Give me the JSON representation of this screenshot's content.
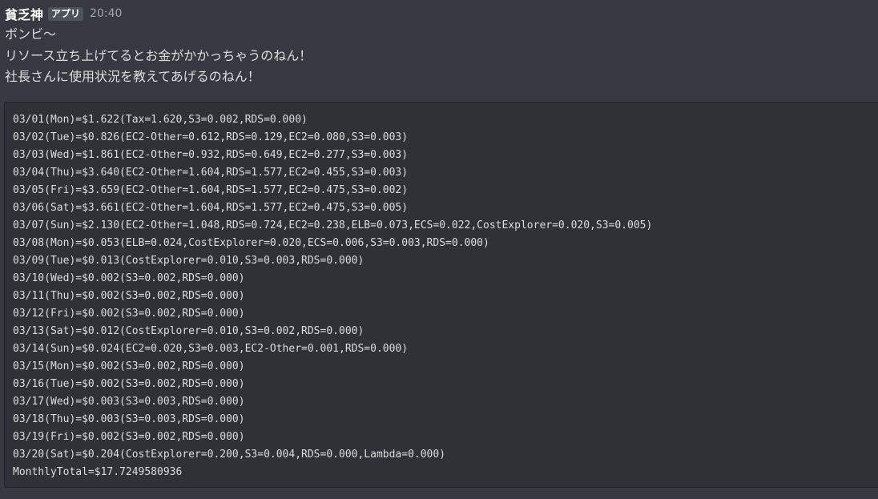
{
  "message": {
    "author": "貧乏神",
    "tag": "アプリ",
    "time": "20:40",
    "lines": [
      "ボンビ〜",
      "リソース立ち上げてるとお金がかかっちゃうのねん！",
      "社長さんに使用状況を教えてあげるのねん！"
    ]
  },
  "codeblock": {
    "lines": [
      "03/01(Mon)=$1.622(Tax=1.620,S3=0.002,RDS=0.000)",
      "03/02(Tue)=$0.826(EC2-Other=0.612,RDS=0.129,EC2=0.080,S3=0.003)",
      "03/03(Wed)=$1.861(EC2-Other=0.932,RDS=0.649,EC2=0.277,S3=0.003)",
      "03/04(Thu)=$3.640(EC2-Other=1.604,RDS=1.577,EC2=0.455,S3=0.003)",
      "03/05(Fri)=$3.659(EC2-Other=1.604,RDS=1.577,EC2=0.475,S3=0.002)",
      "03/06(Sat)=$3.661(EC2-Other=1.604,RDS=1.577,EC2=0.475,S3=0.005)",
      "03/07(Sun)=$2.130(EC2-Other=1.048,RDS=0.724,EC2=0.238,ELB=0.073,ECS=0.022,CostExplorer=0.020,S3=0.005)",
      "03/08(Mon)=$0.053(ELB=0.024,CostExplorer=0.020,ECS=0.006,S3=0.003,RDS=0.000)",
      "03/09(Tue)=$0.013(CostExplorer=0.010,S3=0.003,RDS=0.000)",
      "03/10(Wed)=$0.002(S3=0.002,RDS=0.000)",
      "03/11(Thu)=$0.002(S3=0.002,RDS=0.000)",
      "03/12(Fri)=$0.002(S3=0.002,RDS=0.000)",
      "03/13(Sat)=$0.012(CostExplorer=0.010,S3=0.002,RDS=0.000)",
      "03/14(Sun)=$0.024(EC2=0.020,S3=0.003,EC2-Other=0.001,RDS=0.000)",
      "03/15(Mon)=$0.002(S3=0.002,RDS=0.000)",
      "03/16(Tue)=$0.002(S3=0.002,RDS=0.000)",
      "03/17(Wed)=$0.003(S3=0.003,RDS=0.000)",
      "03/18(Thu)=$0.003(S3=0.003,RDS=0.000)",
      "03/19(Fri)=$0.002(S3=0.002,RDS=0.000)",
      "03/20(Sat)=$0.204(CostExplorer=0.200,S3=0.004,RDS=0.000,Lambda=0.000)",
      "MonthlyTotal=$17.7249580936"
    ]
  }
}
